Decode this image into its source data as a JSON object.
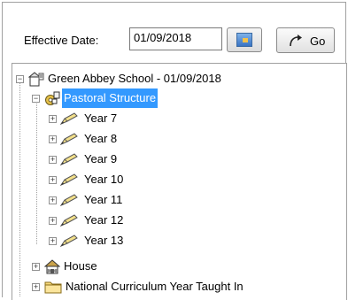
{
  "toolbar": {
    "effective_date_label": "Effective Date:",
    "effective_date_value": "01/09/2018",
    "go_label": "Go"
  },
  "tree": {
    "root": {
      "label": "Green Abbey School - 01/09/2018",
      "icon": "school-icon"
    },
    "pastoral": {
      "label": "Pastoral Structure",
      "icon": "pastoral-structure-icon",
      "selected": true
    },
    "years": [
      {
        "label": "Year  7",
        "icon": "year-group-icon"
      },
      {
        "label": "Year  8",
        "icon": "year-group-icon"
      },
      {
        "label": "Year  9",
        "icon": "year-group-icon"
      },
      {
        "label": "Year 10",
        "icon": "year-group-icon"
      },
      {
        "label": "Year 11",
        "icon": "year-group-icon"
      },
      {
        "label": "Year 12",
        "icon": "year-group-icon"
      },
      {
        "label": "Year 13",
        "icon": "year-group-icon"
      }
    ],
    "house": {
      "label": "House",
      "icon": "house-icon"
    },
    "ncy": {
      "label": "National Curriculum Year Taught In",
      "icon": "folder-icon"
    }
  }
}
